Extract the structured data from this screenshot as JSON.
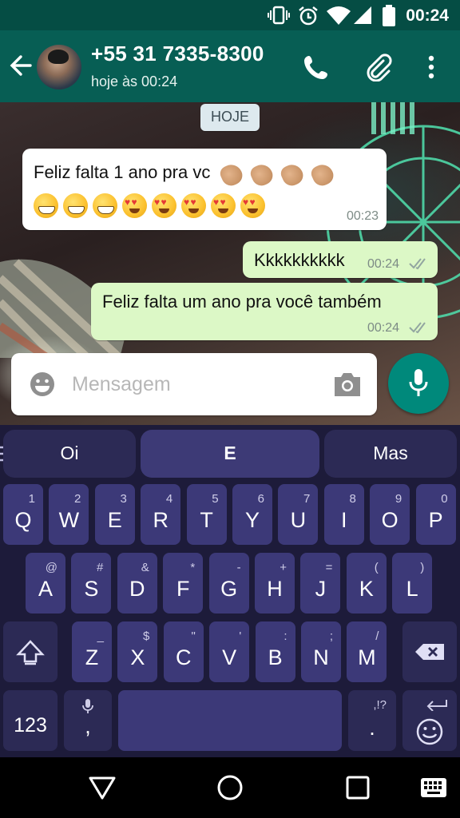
{
  "status_bar": {
    "time": "00:24"
  },
  "header": {
    "contact_name": "+55 31 7335-8300",
    "last_seen": "hoje às 00:24"
  },
  "chat": {
    "date_chip": "HOJE",
    "messages": [
      {
        "direction": "in",
        "text": "Feliz falta 1 ano pra vc",
        "emoji_line": [
          "grin",
          "grin",
          "grin",
          "heart-eyes",
          "heart-eyes",
          "heart-eyes",
          "heart-eyes",
          "heart-eyes"
        ],
        "reaction_emoji": [
          "clap",
          "clap",
          "clap",
          "clap"
        ],
        "time": "00:23"
      },
      {
        "direction": "out",
        "text": "Kkkkkkkkkk",
        "time": "00:24",
        "ticks": "double-check"
      },
      {
        "direction": "out",
        "text": "Feliz falta um ano pra você também",
        "time": "00:24",
        "ticks": "double-check"
      }
    ]
  },
  "composer": {
    "placeholder": "Mensagem"
  },
  "keyboard": {
    "suggestions": [
      "Oi",
      "E",
      "Mas"
    ],
    "row1": [
      {
        "k": "Q",
        "s": "1"
      },
      {
        "k": "W",
        "s": "2"
      },
      {
        "k": "E",
        "s": "3"
      },
      {
        "k": "R",
        "s": "4"
      },
      {
        "k": "T",
        "s": "5"
      },
      {
        "k": "Y",
        "s": "6"
      },
      {
        "k": "U",
        "s": "7"
      },
      {
        "k": "I",
        "s": "8"
      },
      {
        "k": "O",
        "s": "9"
      },
      {
        "k": "P",
        "s": "0"
      }
    ],
    "row2": [
      {
        "k": "A",
        "s": "@"
      },
      {
        "k": "S",
        "s": "#"
      },
      {
        "k": "D",
        "s": "&"
      },
      {
        "k": "F",
        "s": "*"
      },
      {
        "k": "G",
        "s": "-"
      },
      {
        "k": "H",
        "s": "+"
      },
      {
        "k": "J",
        "s": "="
      },
      {
        "k": "K",
        "s": "("
      },
      {
        "k": "L",
        "s": ")"
      }
    ],
    "row3": [
      {
        "k": "Z",
        "s": "_"
      },
      {
        "k": "X",
        "s": "$"
      },
      {
        "k": "C",
        "s": "\""
      },
      {
        "k": "V",
        "s": "'"
      },
      {
        "k": "B",
        "s": ":"
      },
      {
        "k": "N",
        "s": ";"
      },
      {
        "k": "M",
        "s": "/"
      }
    ],
    "numbers_key": "123",
    "comma_key": ",",
    "period_key": ".",
    "period_sub": ",!?"
  },
  "colors": {
    "header": "#075e54",
    "status": "#054d44",
    "accent": "#00897b",
    "out_bubble": "#dcf8c6",
    "key": "#3c3978",
    "keyboard_bg": "#1d1b3a"
  },
  "icons": [
    "vibrate-icon",
    "alarm-icon",
    "wifi-icon",
    "signal-icon",
    "battery-icon",
    "back-arrow-icon",
    "phone-icon",
    "attach-icon",
    "more-vert-icon",
    "emoji-icon",
    "camera-icon",
    "mic-icon",
    "shift-icon",
    "backspace-icon",
    "enter-icon",
    "smiley-icon",
    "nav-back-icon",
    "nav-home-icon",
    "nav-recents-icon",
    "keyboard-switch-icon"
  ]
}
